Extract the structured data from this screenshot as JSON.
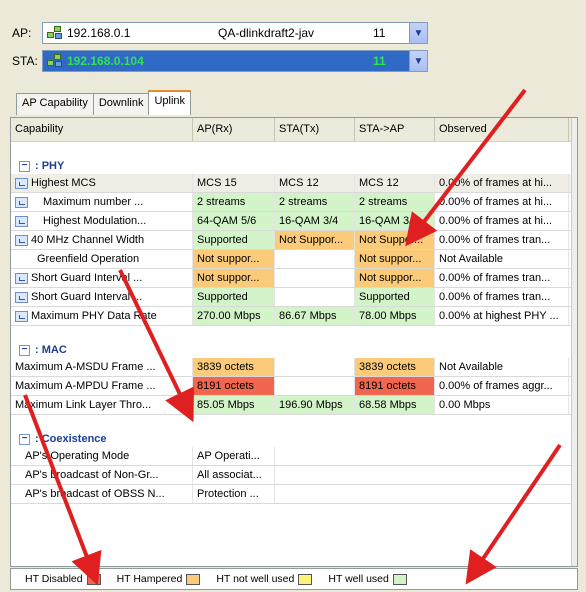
{
  "ap": {
    "label": "AP:",
    "ip": "192.168.0.1",
    "ssid": "QA-dlinkdraft2-jav",
    "channel": "11"
  },
  "sta": {
    "label": "STA:",
    "ip": "192.168.0.104",
    "channel": "11"
  },
  "tabs": [
    "AP Capability",
    "Downlink",
    "Uplink"
  ],
  "columns": [
    "Capability",
    "AP(Rx)",
    "STA(Tx)",
    "STA->AP",
    "Observed"
  ],
  "sections": {
    "phy": ": PHY",
    "mac": ": MAC",
    "coex": ": Coexistence"
  },
  "phy_rows": [
    {
      "name": "Highest MCS",
      "ap": "MCS 15",
      "sta": "MCS 12",
      "sta_ap": "MCS 12",
      "obs": "0.00% of frames at hi..."
    },
    {
      "name": "Maximum number ...",
      "ap": "2 streams",
      "sta": "2 streams",
      "sta_ap": "2 streams",
      "obs": "0.00% of frames at hi..."
    },
    {
      "name": "Highest Modulation...",
      "ap": "64-QAM 5/6",
      "sta": "16-QAM 3/4",
      "sta_ap": "16-QAM 3/4",
      "obs": "0.00% of frames at hi..."
    },
    {
      "name": "40 MHz Channel Width",
      "ap": "Supported",
      "sta": "Not Suppor...",
      "sta_ap": "Not Suppor...",
      "obs": "0.00% of frames tran..."
    },
    {
      "name": "Greenfield Operation",
      "ap": "Not suppor...",
      "sta": "",
      "sta_ap": "Not suppor...",
      "obs": "Not Available"
    },
    {
      "name": "Short Guard Interval ...",
      "ap": "Not suppor...",
      "sta": "",
      "sta_ap": "Not suppor...",
      "obs": "0.00% of frames tran..."
    },
    {
      "name": "Short Guard Interval ...",
      "ap": "Supported",
      "sta": "",
      "sta_ap": "Supported",
      "obs": "0.00% of frames tran..."
    },
    {
      "name": "Maximum PHY Data Rate",
      "ap": "270.00 Mbps",
      "sta": "86.67 Mbps",
      "sta_ap": "78.00 Mbps",
      "obs": "0.00% at highest PHY ..."
    }
  ],
  "mac_rows": [
    {
      "name": "Maximum A-MSDU Frame ...",
      "ap": "3839 octets",
      "sta": "",
      "sta_ap": "3839 octets",
      "obs": "Not Available"
    },
    {
      "name": "Maximum A-MPDU Frame ...",
      "ap": "8191 octets",
      "sta": "",
      "sta_ap": "8191 octets",
      "obs": "0.00% of frames aggr..."
    },
    {
      "name": "Maximum Link Layer Thro...",
      "ap": "85.05 Mbps",
      "sta": "196.90 Mbps",
      "sta_ap": "68.58 Mbps",
      "obs": "0.00 Mbps"
    }
  ],
  "coex_rows": [
    {
      "name": "AP's Operating Mode",
      "ap": "AP Operati..."
    },
    {
      "name": "AP's broadcast of Non-Gr...",
      "ap": "All associat..."
    },
    {
      "name": "AP's broadcast of OBSS N...",
      "ap": "Protection ..."
    }
  ],
  "legend": [
    "HT Disabled",
    "HT Hampered",
    "HT not well used",
    "HT well used"
  ],
  "colors": {
    "disabled": "#f0664e",
    "hampered": "#fbcb7a",
    "not_well_used": "#fff27a",
    "well_used": "#d3f3c9",
    "arrow": "#e02020"
  }
}
